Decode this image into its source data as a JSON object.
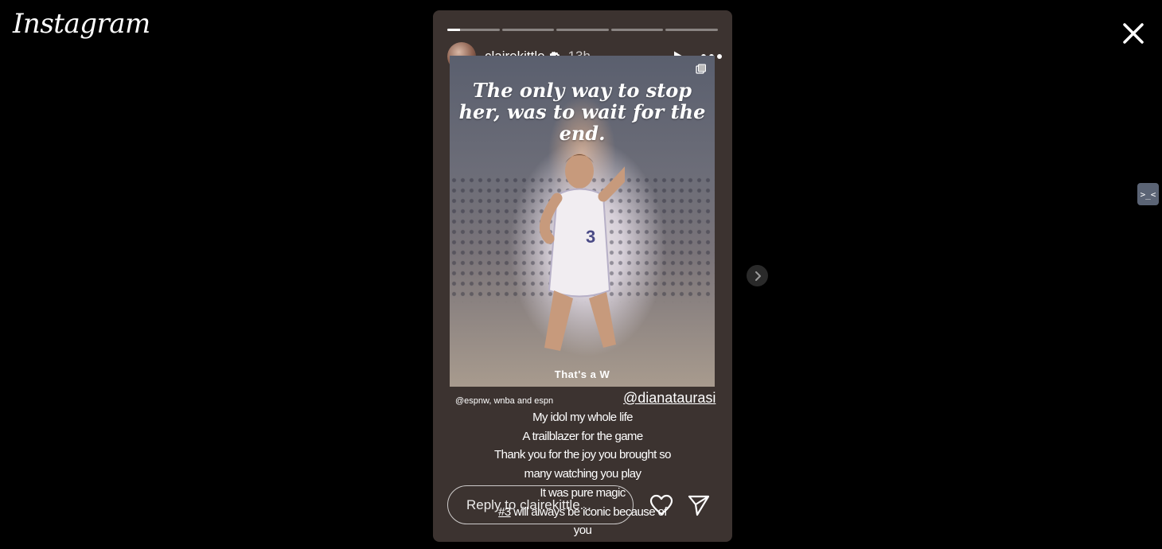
{
  "app": {
    "logo_text": "Instagram"
  },
  "story": {
    "username": "clairekittle",
    "time_ago": "13h",
    "verified": true,
    "progress": {
      "segments": 5,
      "active_index": 0,
      "active_fraction": 0.25
    },
    "image": {
      "headline": "The only way to stop her, was to wait for the end.",
      "tagline": "That's a W"
    },
    "credit": "@espnw, wnba and espn",
    "mention": "@dianataurasi",
    "caption_lines": [
      "My idol my whole life",
      "A trailblazer for the game",
      "Thank you for the joy you brought so",
      "many watching you play",
      "It was pure magic",
      "#3 will always be iconic because of",
      "you"
    ],
    "caption_hashtag": "#3"
  },
  "reply": {
    "placeholder": "Reply to clairekittle..."
  },
  "icons": {
    "close": "close-icon",
    "play": "play-icon",
    "more": "more-icon",
    "verified": "verified-badge-icon",
    "like": "heart-icon",
    "share": "send-icon",
    "next": "chevron-right-icon",
    "extension": "extension-icon"
  },
  "colors": {
    "background": "#000000",
    "story_background": "#3c3330",
    "text": "#ffffff",
    "verified_badge": "#ffffff"
  }
}
